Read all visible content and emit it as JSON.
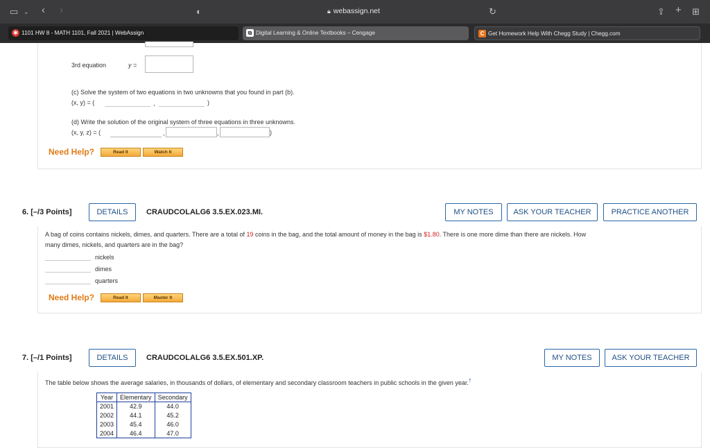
{
  "browser": {
    "url": "webassign.net",
    "tabs": [
      {
        "title": "1101 HW 8 - MATH 1101, Fall 2021 | WebAssign",
        "icon": "webassign-icon"
      },
      {
        "title": "Digital Learning & Online Textbooks – Cengage",
        "icon": "cengage-icon"
      },
      {
        "title": "Get Homework Help With Chegg Study | Chegg.com",
        "icon": "chegg-icon"
      }
    ]
  },
  "prev_question": {
    "third_eq_label": "3rd equation",
    "third_eq_var": "y =",
    "part_c_text": "(c) Solve the system of two equations in two unknowns that you found in part (b).",
    "part_c_lhs": "(x, y) = (",
    "part_c_comma": ",",
    "part_c_close": ")",
    "part_d_text": "(d) Write the solution of the original system of three equations in three unknowns.",
    "part_d_lhs": "(x, y, z) = (",
    "part_d_comma1": ",",
    "part_d_comma2": ",",
    "part_d_close": ")",
    "need_help": "Need Help?",
    "btn1": "Read It",
    "btn2": "Watch It"
  },
  "q6": {
    "number": "6.  [–/3 Points]",
    "details": "DETAILS",
    "id": "CRAUDCOLALG6 3.5.EX.023.MI.",
    "my_notes": "MY NOTES",
    "ask_teacher": "ASK YOUR TEACHER",
    "practice": "PRACTICE ANOTHER",
    "text_a": "A bag of coins contains nickels, dimes, and quarters. There are a total of ",
    "coins": "19",
    "text_b": " coins in the bag, and the total amount of money in the bag is ",
    "money": "$1.80",
    "text_c": ". There is one more dime than there are nickels. How",
    "text_line2": "many dimes, nickels, and quarters are in the bag?",
    "answers": [
      "nickels",
      "dimes",
      "quarters"
    ],
    "need_help": "Need Help?",
    "btn1": "Read It",
    "btn2": "Master It"
  },
  "q7": {
    "number": "7.  [–/1 Points]",
    "details": "DETAILS",
    "id": "CRAUDCOLALG6 3.5.EX.501.XP.",
    "my_notes": "MY NOTES",
    "ask_teacher": "ASK YOUR TEACHER",
    "text": "The table below shows the average salaries, in thousands of dollars, of elementary and secondary classroom teachers in public schools in the given year.",
    "footnote": "†",
    "table": {
      "headers": [
        "Year",
        "Elementary",
        "Secondary"
      ],
      "rows": [
        [
          "2001",
          "42.9",
          "44.0"
        ],
        [
          "2002",
          "44.1",
          "45.2"
        ],
        [
          "2003",
          "45.4",
          "46.0"
        ],
        [
          "2004",
          "46.4",
          "47.0"
        ]
      ]
    }
  },
  "colors": {
    "orange": "#e07b16",
    "blue": "#2b66a6",
    "red": "#cc2222"
  }
}
